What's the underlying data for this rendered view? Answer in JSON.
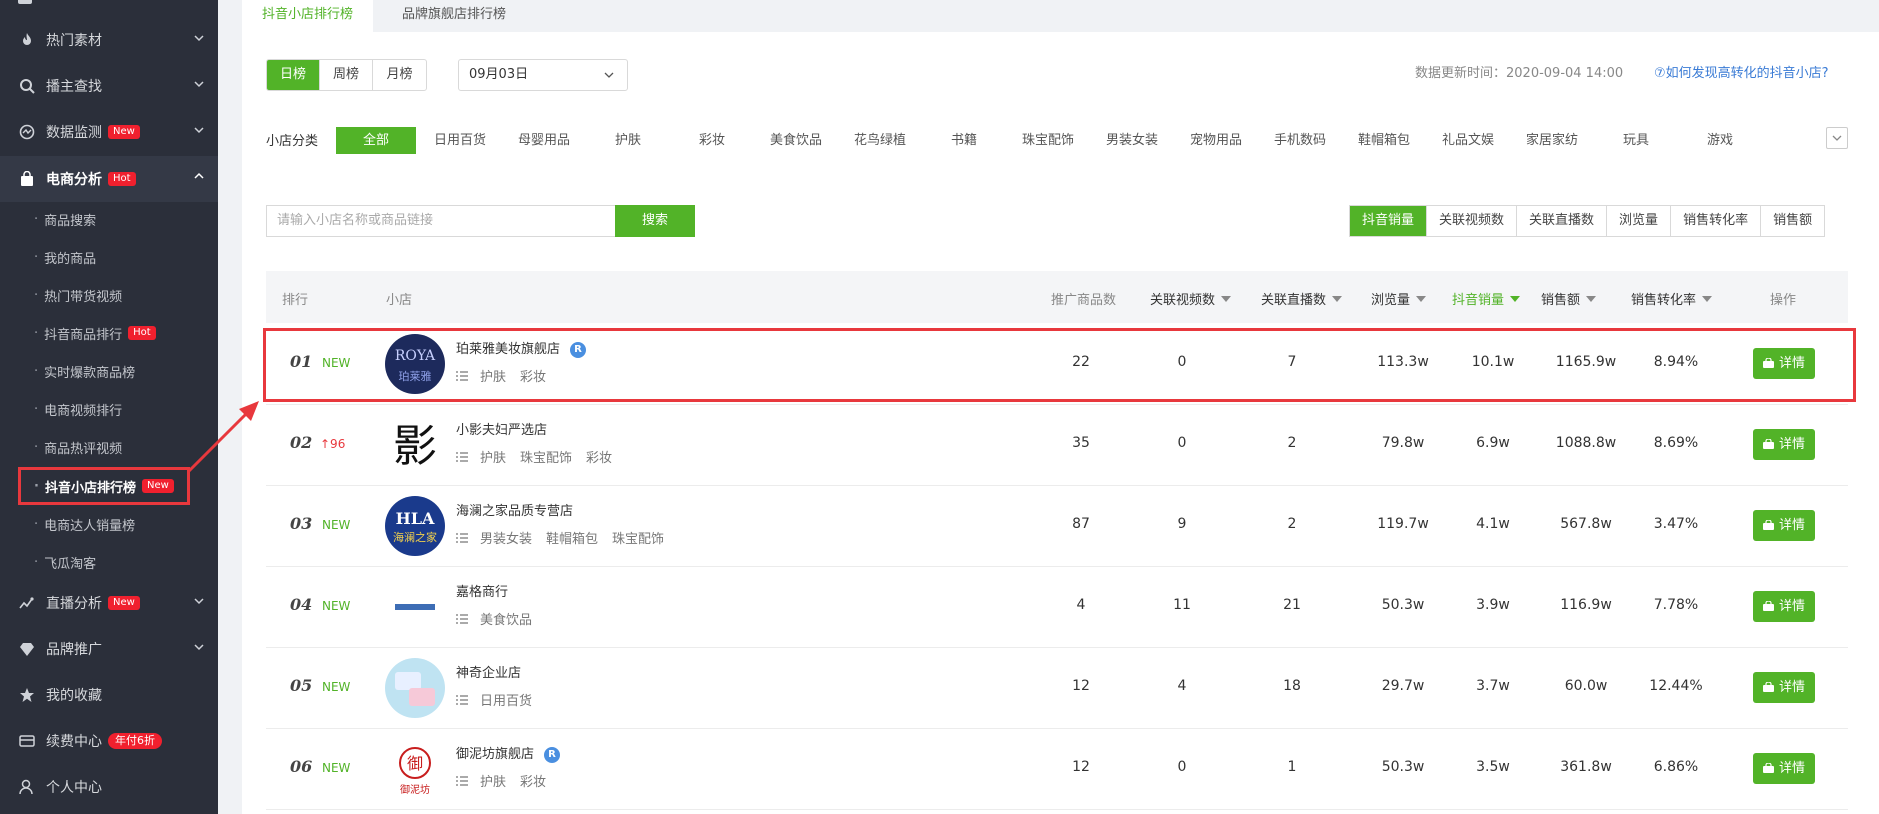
{
  "sidebar": {
    "items": [
      {
        "label": "热门素材",
        "icon": "fire-icon"
      },
      {
        "label": "播主查找",
        "icon": "search-icon"
      },
      {
        "label": "数据监测",
        "icon": "monitor-icon",
        "badge": "New"
      },
      {
        "label": "电商分析",
        "icon": "shopping-bag-icon",
        "badge": "Hot"
      },
      {
        "label": "直播分析",
        "icon": "line-chart-icon",
        "badge": "New"
      },
      {
        "label": "品牌推广",
        "icon": "diamond-icon"
      },
      {
        "label": "我的收藏",
        "icon": "star-icon"
      },
      {
        "label": "续费中心",
        "icon": "card-icon",
        "badge": "年付6折"
      },
      {
        "label": "个人中心",
        "icon": "user-icon"
      }
    ],
    "sub_items": [
      {
        "label": "商品搜索"
      },
      {
        "label": "我的商品"
      },
      {
        "label": "热门带货视频"
      },
      {
        "label": "抖音商品排行",
        "badge": "Hot"
      },
      {
        "label": "实时爆款商品榜"
      },
      {
        "label": "电商视频排行"
      },
      {
        "label": "商品热评视频"
      },
      {
        "label": "抖音小店排行榜",
        "badge": "New"
      },
      {
        "label": "电商达人销量榜"
      },
      {
        "label": "飞瓜淘客"
      }
    ]
  },
  "tabs": [
    {
      "label": "抖音小店排行榜"
    },
    {
      "label": "品牌旗舰店排行榜"
    }
  ],
  "period": [
    "日榜",
    "周榜",
    "月榜"
  ],
  "date": "09月03日",
  "update_time": "数据更新时间：2020-09-04 14:00",
  "help_link": "⑦如何发现高转化的抖音小店?",
  "category_label": "小店分类",
  "categories": [
    "全部",
    "日用百货",
    "母婴用品",
    "护肤",
    "彩妆",
    "美食饮品",
    "花鸟绿植",
    "书籍",
    "珠宝配饰",
    "男装女装",
    "宠物用品",
    "手机数码",
    "鞋帽箱包",
    "礼品文娱",
    "家居家纺",
    "玩具",
    "游戏"
  ],
  "search": {
    "placeholder": "请输入小店名称或商品链接",
    "button": "搜索"
  },
  "sort_tabs": [
    "抖音销量",
    "关联视频数",
    "关联直播数",
    "浏览量",
    "销售转化率",
    "销售额"
  ],
  "columns": [
    "排行",
    "小店",
    "推广商品数",
    "关联视频数",
    "关联直播数",
    "浏览量",
    "抖音销量",
    "销售额",
    "销售转化率",
    "操作"
  ],
  "detail_label": "详情",
  "rows": [
    {
      "rank": "01",
      "trend": "NEW",
      "name": "珀莱雅美妆旗舰店",
      "verified": "R",
      "tags": [
        "护肤",
        "彩妆"
      ],
      "products": "22",
      "videos": "0",
      "lives": "7",
      "views": "113.3w",
      "sales": "10.1w",
      "revenue": "1165.9w",
      "conversion": "8.94%"
    },
    {
      "rank": "02",
      "trend": "↑96",
      "name": "小影夫妇严选店",
      "tags": [
        "护肤",
        "珠宝配饰",
        "彩妆"
      ],
      "products": "35",
      "videos": "0",
      "lives": "2",
      "views": "79.8w",
      "sales": "6.9w",
      "revenue": "1088.8w",
      "conversion": "8.69%"
    },
    {
      "rank": "03",
      "trend": "NEW",
      "name": "海澜之家品质专营店",
      "tags": [
        "男装女装",
        "鞋帽箱包",
        "珠宝配饰"
      ],
      "products": "87",
      "videos": "9",
      "lives": "2",
      "views": "119.7w",
      "sales": "4.1w",
      "revenue": "567.8w",
      "conversion": "3.47%"
    },
    {
      "rank": "04",
      "trend": "NEW",
      "name": "嘉格商行",
      "tags": [
        "美食饮品"
      ],
      "products": "4",
      "videos": "11",
      "lives": "21",
      "views": "50.3w",
      "sales": "3.9w",
      "revenue": "116.9w",
      "conversion": "7.78%"
    },
    {
      "rank": "05",
      "trend": "NEW",
      "name": "神奇企业店",
      "tags": [
        "日用百货"
      ],
      "products": "12",
      "videos": "4",
      "lives": "18",
      "views": "29.7w",
      "sales": "3.7w",
      "revenue": "60.0w",
      "conversion": "12.44%"
    },
    {
      "rank": "06",
      "trend": "NEW",
      "name": "御泥坊旗舰店",
      "verified": "R",
      "tags": [
        "护肤",
        "彩妆"
      ],
      "products": "12",
      "videos": "0",
      "lives": "1",
      "views": "50.3w",
      "sales": "3.5w",
      "revenue": "361.8w",
      "conversion": "6.86%"
    }
  ],
  "logos": {
    "row0": "ROYA 珀莱雅",
    "row1": "影",
    "row2": "HLA 海澜之家",
    "row5": "御 御泥坊"
  },
  "colors": {
    "accent": "#52b328",
    "sidebar_bg": "#2b2f3a",
    "highlight": "#e8383d",
    "badge": "#f0202e"
  }
}
